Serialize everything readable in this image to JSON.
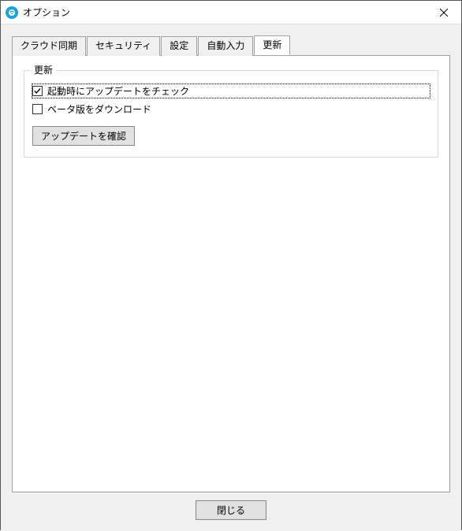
{
  "window": {
    "title": "オプション"
  },
  "tabs": [
    {
      "label": "クラウド同期"
    },
    {
      "label": "セキュリティ"
    },
    {
      "label": "設定"
    },
    {
      "label": "自動入力"
    },
    {
      "label": "更新"
    }
  ],
  "active_tab_index": 4,
  "update_panel": {
    "legend": "更新",
    "checkbox_startup": {
      "label": "起動時にアップデートをチェック",
      "checked": true
    },
    "checkbox_beta": {
      "label": "ベータ版をダウンロード",
      "checked": false
    },
    "check_updates_button": "アップデートを確認"
  },
  "footer": {
    "close_button": "閉じる"
  }
}
